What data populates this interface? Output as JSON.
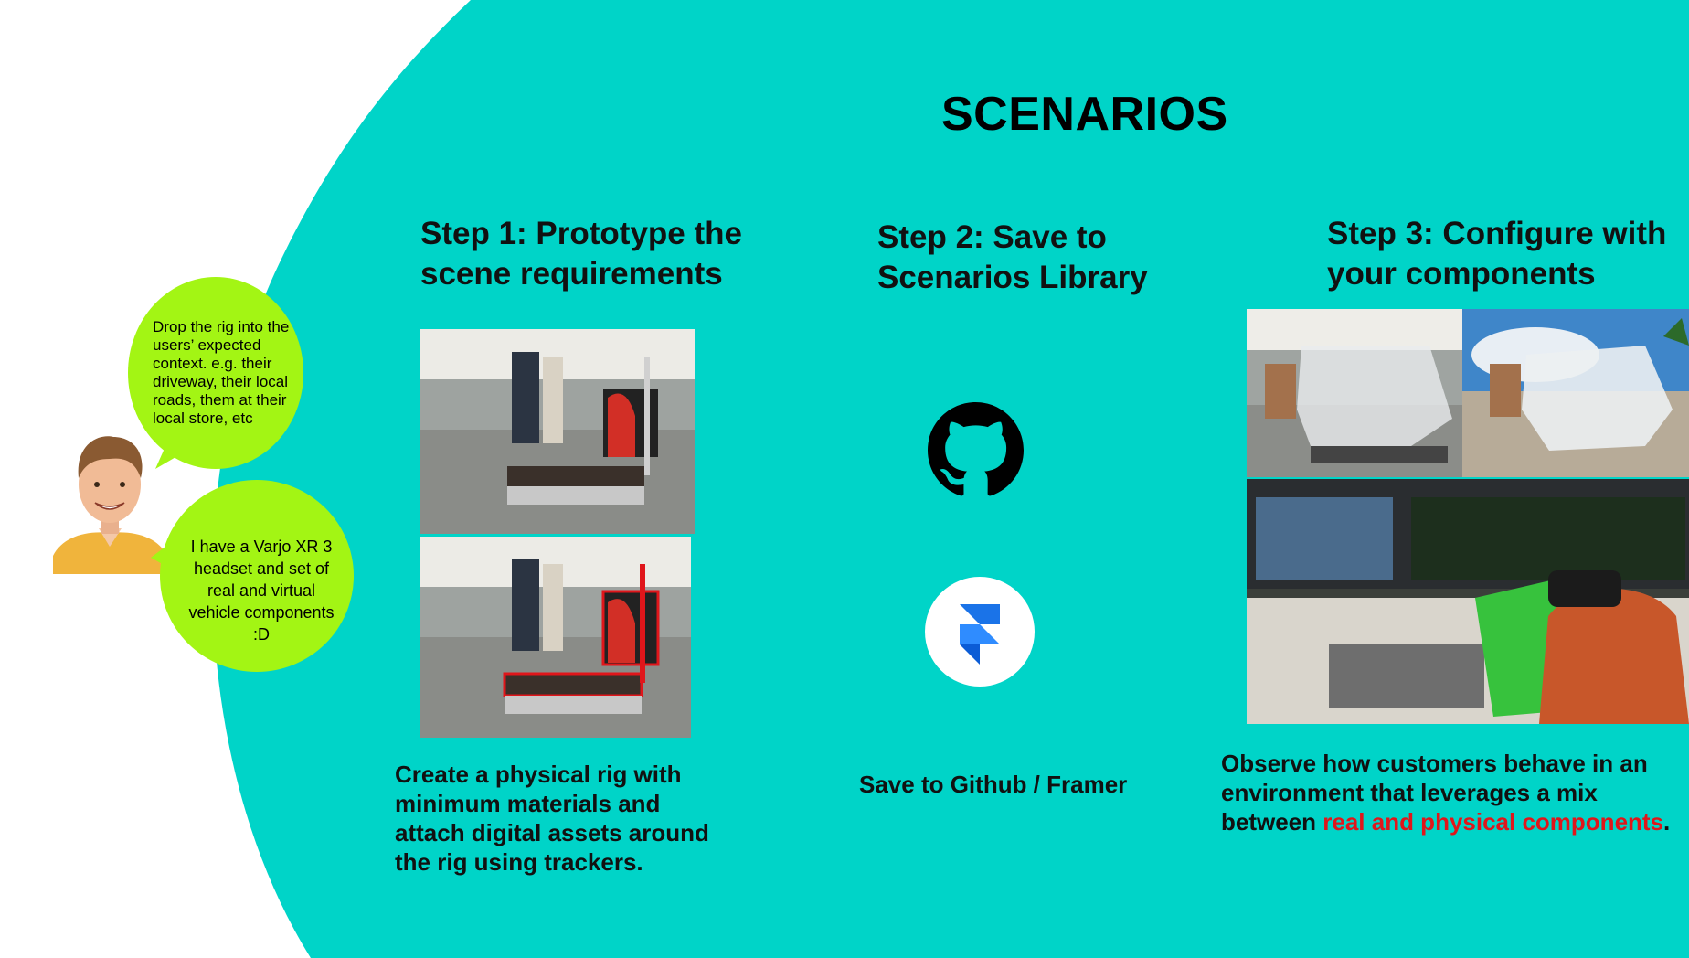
{
  "title": "SCENARIOS",
  "colors": {
    "background": "#00d4c8",
    "bubble": "#a3f514",
    "highlight": "#e0161b",
    "github": "#000000",
    "framer_blue": "#1a73e8"
  },
  "persona": {
    "bubble_1": "Drop the rig into the users’ expected context. e.g. their driveway, their local roads, them at their local store, etc",
    "bubble_2_lines": [
      "I have a Varjo XR 3",
      "headset and set of",
      "real and virtual",
      "vehicle components",
      ":D"
    ]
  },
  "steps": [
    {
      "title_lines": [
        "Step 1: Prototype the",
        "scene requirements"
      ],
      "caption_lines": [
        "Create a physical rig with",
        "minimum materials and",
        "attach digital assets around",
        "the rig using trackers."
      ]
    },
    {
      "title_lines": [
        "Step 2: Save to",
        "Scenarios Library"
      ],
      "caption": "Save to Github / Framer",
      "icons": [
        "github-icon",
        "framer-icon"
      ]
    },
    {
      "title_lines": [
        "Step 3: Configure with",
        "your components"
      ],
      "caption_lines": [
        "Observe how customers behave in an",
        "environment that leverages a mix"
      ],
      "caption_last_prefix": "between ",
      "caption_last_highlight": "real and physical components",
      "caption_last_suffix": "."
    }
  ]
}
